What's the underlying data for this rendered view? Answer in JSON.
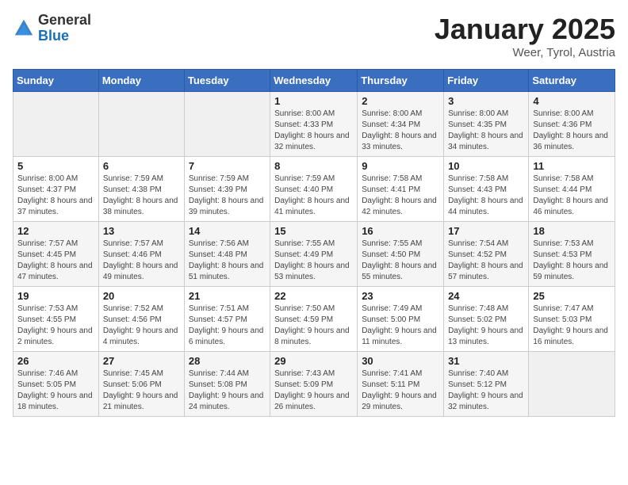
{
  "header": {
    "logo_general": "General",
    "logo_blue": "Blue",
    "month_title": "January 2025",
    "location": "Weer, Tyrol, Austria"
  },
  "weekdays": [
    "Sunday",
    "Monday",
    "Tuesday",
    "Wednesday",
    "Thursday",
    "Friday",
    "Saturday"
  ],
  "weeks": [
    [
      {
        "day": "",
        "info": ""
      },
      {
        "day": "",
        "info": ""
      },
      {
        "day": "",
        "info": ""
      },
      {
        "day": "1",
        "info": "Sunrise: 8:00 AM\nSunset: 4:33 PM\nDaylight: 8 hours and 32 minutes."
      },
      {
        "day": "2",
        "info": "Sunrise: 8:00 AM\nSunset: 4:34 PM\nDaylight: 8 hours and 33 minutes."
      },
      {
        "day": "3",
        "info": "Sunrise: 8:00 AM\nSunset: 4:35 PM\nDaylight: 8 hours and 34 minutes."
      },
      {
        "day": "4",
        "info": "Sunrise: 8:00 AM\nSunset: 4:36 PM\nDaylight: 8 hours and 36 minutes."
      }
    ],
    [
      {
        "day": "5",
        "info": "Sunrise: 8:00 AM\nSunset: 4:37 PM\nDaylight: 8 hours and 37 minutes."
      },
      {
        "day": "6",
        "info": "Sunrise: 7:59 AM\nSunset: 4:38 PM\nDaylight: 8 hours and 38 minutes."
      },
      {
        "day": "7",
        "info": "Sunrise: 7:59 AM\nSunset: 4:39 PM\nDaylight: 8 hours and 39 minutes."
      },
      {
        "day": "8",
        "info": "Sunrise: 7:59 AM\nSunset: 4:40 PM\nDaylight: 8 hours and 41 minutes."
      },
      {
        "day": "9",
        "info": "Sunrise: 7:58 AM\nSunset: 4:41 PM\nDaylight: 8 hours and 42 minutes."
      },
      {
        "day": "10",
        "info": "Sunrise: 7:58 AM\nSunset: 4:43 PM\nDaylight: 8 hours and 44 minutes."
      },
      {
        "day": "11",
        "info": "Sunrise: 7:58 AM\nSunset: 4:44 PM\nDaylight: 8 hours and 46 minutes."
      }
    ],
    [
      {
        "day": "12",
        "info": "Sunrise: 7:57 AM\nSunset: 4:45 PM\nDaylight: 8 hours and 47 minutes."
      },
      {
        "day": "13",
        "info": "Sunrise: 7:57 AM\nSunset: 4:46 PM\nDaylight: 8 hours and 49 minutes."
      },
      {
        "day": "14",
        "info": "Sunrise: 7:56 AM\nSunset: 4:48 PM\nDaylight: 8 hours and 51 minutes."
      },
      {
        "day": "15",
        "info": "Sunrise: 7:55 AM\nSunset: 4:49 PM\nDaylight: 8 hours and 53 minutes."
      },
      {
        "day": "16",
        "info": "Sunrise: 7:55 AM\nSunset: 4:50 PM\nDaylight: 8 hours and 55 minutes."
      },
      {
        "day": "17",
        "info": "Sunrise: 7:54 AM\nSunset: 4:52 PM\nDaylight: 8 hours and 57 minutes."
      },
      {
        "day": "18",
        "info": "Sunrise: 7:53 AM\nSunset: 4:53 PM\nDaylight: 8 hours and 59 minutes."
      }
    ],
    [
      {
        "day": "19",
        "info": "Sunrise: 7:53 AM\nSunset: 4:55 PM\nDaylight: 9 hours and 2 minutes."
      },
      {
        "day": "20",
        "info": "Sunrise: 7:52 AM\nSunset: 4:56 PM\nDaylight: 9 hours and 4 minutes."
      },
      {
        "day": "21",
        "info": "Sunrise: 7:51 AM\nSunset: 4:57 PM\nDaylight: 9 hours and 6 minutes."
      },
      {
        "day": "22",
        "info": "Sunrise: 7:50 AM\nSunset: 4:59 PM\nDaylight: 9 hours and 8 minutes."
      },
      {
        "day": "23",
        "info": "Sunrise: 7:49 AM\nSunset: 5:00 PM\nDaylight: 9 hours and 11 minutes."
      },
      {
        "day": "24",
        "info": "Sunrise: 7:48 AM\nSunset: 5:02 PM\nDaylight: 9 hours and 13 minutes."
      },
      {
        "day": "25",
        "info": "Sunrise: 7:47 AM\nSunset: 5:03 PM\nDaylight: 9 hours and 16 minutes."
      }
    ],
    [
      {
        "day": "26",
        "info": "Sunrise: 7:46 AM\nSunset: 5:05 PM\nDaylight: 9 hours and 18 minutes."
      },
      {
        "day": "27",
        "info": "Sunrise: 7:45 AM\nSunset: 5:06 PM\nDaylight: 9 hours and 21 minutes."
      },
      {
        "day": "28",
        "info": "Sunrise: 7:44 AM\nSunset: 5:08 PM\nDaylight: 9 hours and 24 minutes."
      },
      {
        "day": "29",
        "info": "Sunrise: 7:43 AM\nSunset: 5:09 PM\nDaylight: 9 hours and 26 minutes."
      },
      {
        "day": "30",
        "info": "Sunrise: 7:41 AM\nSunset: 5:11 PM\nDaylight: 9 hours and 29 minutes."
      },
      {
        "day": "31",
        "info": "Sunrise: 7:40 AM\nSunset: 5:12 PM\nDaylight: 9 hours and 32 minutes."
      },
      {
        "day": "",
        "info": ""
      }
    ]
  ]
}
